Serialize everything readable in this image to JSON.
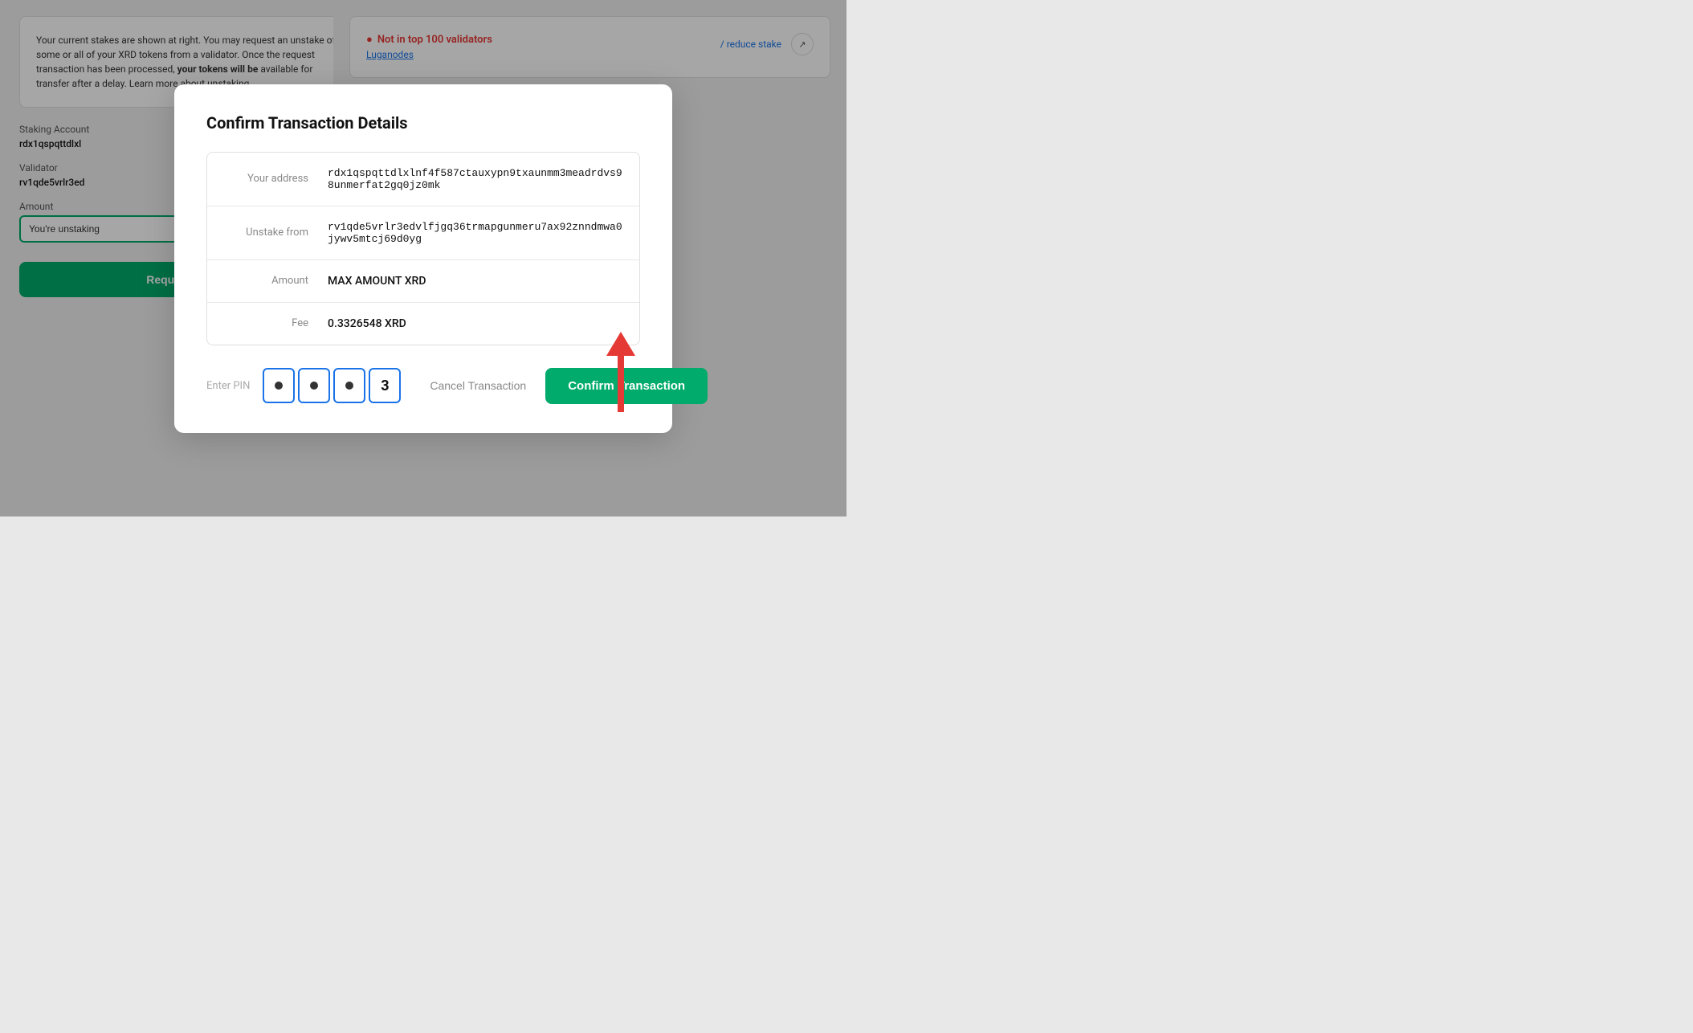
{
  "page": {
    "background": {
      "info_text": "Your current stakes are shown at right. You may request an unstake of some or all of your XRD tokens from a validator. Once the request transaction has been processed,",
      "info_bold": "your tokens will be",
      "info_cont": "available for transfer after a delay. Learn more about unstaking.",
      "staking_account_label": "Staking Account",
      "staking_account_value": "rdx1qspqttdlxl",
      "validator_label": "Validator",
      "validator_value": "rv1qde5vrlr3ed",
      "amount_label": "Amount",
      "amount_input_value": "You're unstaking",
      "request_btn_label": "Reques",
      "not_top_text": "Not in top 100 validators",
      "validator_name": "Luganodes",
      "reduce_stake_text": "reduce stake",
      "external_icon": "↗"
    },
    "modal": {
      "title": "Confirm Transaction Details",
      "your_address_label": "Your address",
      "your_address_value": "rdx1qspqttdlxlnf4f587ctauxypn9txaunmm3meadrdvs98unmerfat2gq0jz0mk",
      "unstake_from_label": "Unstake from",
      "unstake_from_value": "rv1qde5vrlr3edvlfjgq36trmapgunmeru7ax92znndmwa0jywv5mtcj69d0yg",
      "amount_label": "Amount",
      "amount_value": "MAX AMOUNT XRD",
      "fee_label": "Fee",
      "fee_value": "0.3326548 XRD",
      "pin_placeholder": "Enter PIN",
      "pin_digits": [
        "●",
        "●",
        "●",
        "3"
      ],
      "cancel_label": "Cancel Transaction",
      "confirm_label": "Confirm Transaction"
    }
  }
}
